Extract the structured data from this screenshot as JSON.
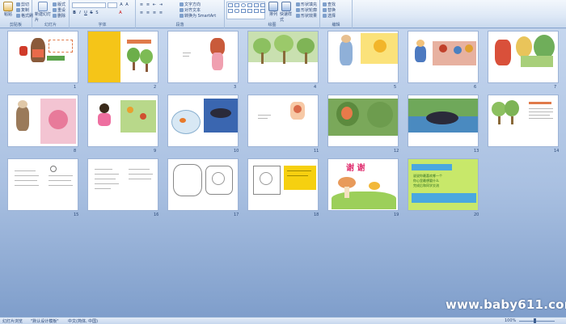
{
  "ribbon": {
    "clipboard": {
      "label": "剪贴板",
      "paste": "粘贴",
      "cut": "剪切",
      "copy": "复制",
      "format_painter": "格式刷"
    },
    "slides": {
      "label": "幻灯片",
      "new_slide": "新建幻灯片",
      "layout": "版式",
      "reset": "重设",
      "delete": "删除"
    },
    "font": {
      "label": "字体",
      "font_name": "",
      "font_size": ""
    },
    "paragraph": {
      "label": "段落",
      "text_direction": "文字方向",
      "align_text": "对齐文本",
      "smartart": "转换为 SmartArt"
    },
    "drawing": {
      "label": "绘图",
      "arrange": "排列",
      "quick_styles": "快速样式",
      "shape_fill": "形状填充",
      "shape_outline": "形状轮廓",
      "shape_effects": "形状效果"
    },
    "editing": {
      "label": "编辑",
      "find": "查找",
      "replace": "替换",
      "select": "选择"
    }
  },
  "slides": [
    {
      "num": "1",
      "theme": "cover-girl"
    },
    {
      "num": "2",
      "theme": "title-yellow"
    },
    {
      "num": "3",
      "theme": "girl-dance"
    },
    {
      "num": "4",
      "theme": "tree-forest"
    },
    {
      "num": "5",
      "theme": "boy-sun"
    },
    {
      "num": "6",
      "theme": "kids-group"
    },
    {
      "num": "7",
      "theme": "walker"
    },
    {
      "num": "8",
      "theme": "grandma"
    },
    {
      "num": "9",
      "theme": "girl-pink"
    },
    {
      "num": "10",
      "theme": "fish"
    },
    {
      "num": "11",
      "theme": "small-pic"
    },
    {
      "num": "12",
      "theme": "tree-face"
    },
    {
      "num": "13",
      "theme": "whale"
    },
    {
      "num": "14",
      "theme": "trees-text"
    },
    {
      "num": "15",
      "theme": "text"
    },
    {
      "num": "16",
      "theme": "text2"
    },
    {
      "num": "17",
      "theme": "coloring"
    },
    {
      "num": "18",
      "theme": "sketch-yellow"
    },
    {
      "num": "19",
      "theme": "thanks",
      "title": "谢 谢"
    },
    {
      "num": "20",
      "theme": "green",
      "lines": [
        "说说你最喜欢哪一个",
        "你心里最想要什么",
        "完成后和同学交流"
      ]
    }
  ],
  "branding": {
    "watermark": "www.baby611.com"
  },
  "status": {
    "left": "幻灯片浏览",
    "theme": "\"默认设计模板\"",
    "language": "中文(简体, 中国)",
    "zoom": "100%"
  },
  "colors": {
    "ribbon": "#dde8f6",
    "sorter_top": "#c5d6ee",
    "sorter_bottom": "#7f9ecb",
    "accent": "#15428b"
  }
}
